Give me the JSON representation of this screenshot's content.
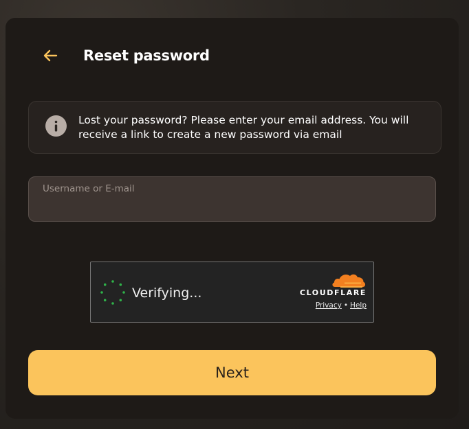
{
  "header": {
    "back_icon": "arrow-left-icon",
    "title": "Reset password"
  },
  "info": {
    "icon": "info-icon",
    "text": "Lost your password? Please enter your email address. You will receive a link to create a new password via email"
  },
  "form": {
    "username_label": "Username or E-mail",
    "username_value": ""
  },
  "captcha": {
    "status_text": "Verifying...",
    "brand": "CLOUDFLARE",
    "privacy_label": "Privacy",
    "separator": "•",
    "help_label": "Help",
    "spinner_color": "#2fb34a",
    "cloud_color": "#f38020"
  },
  "actions": {
    "next_label": "Next"
  },
  "colors": {
    "accent": "#fbc45c",
    "card_bg": "#1e1a17",
    "back_arrow": "#fbc45c"
  }
}
